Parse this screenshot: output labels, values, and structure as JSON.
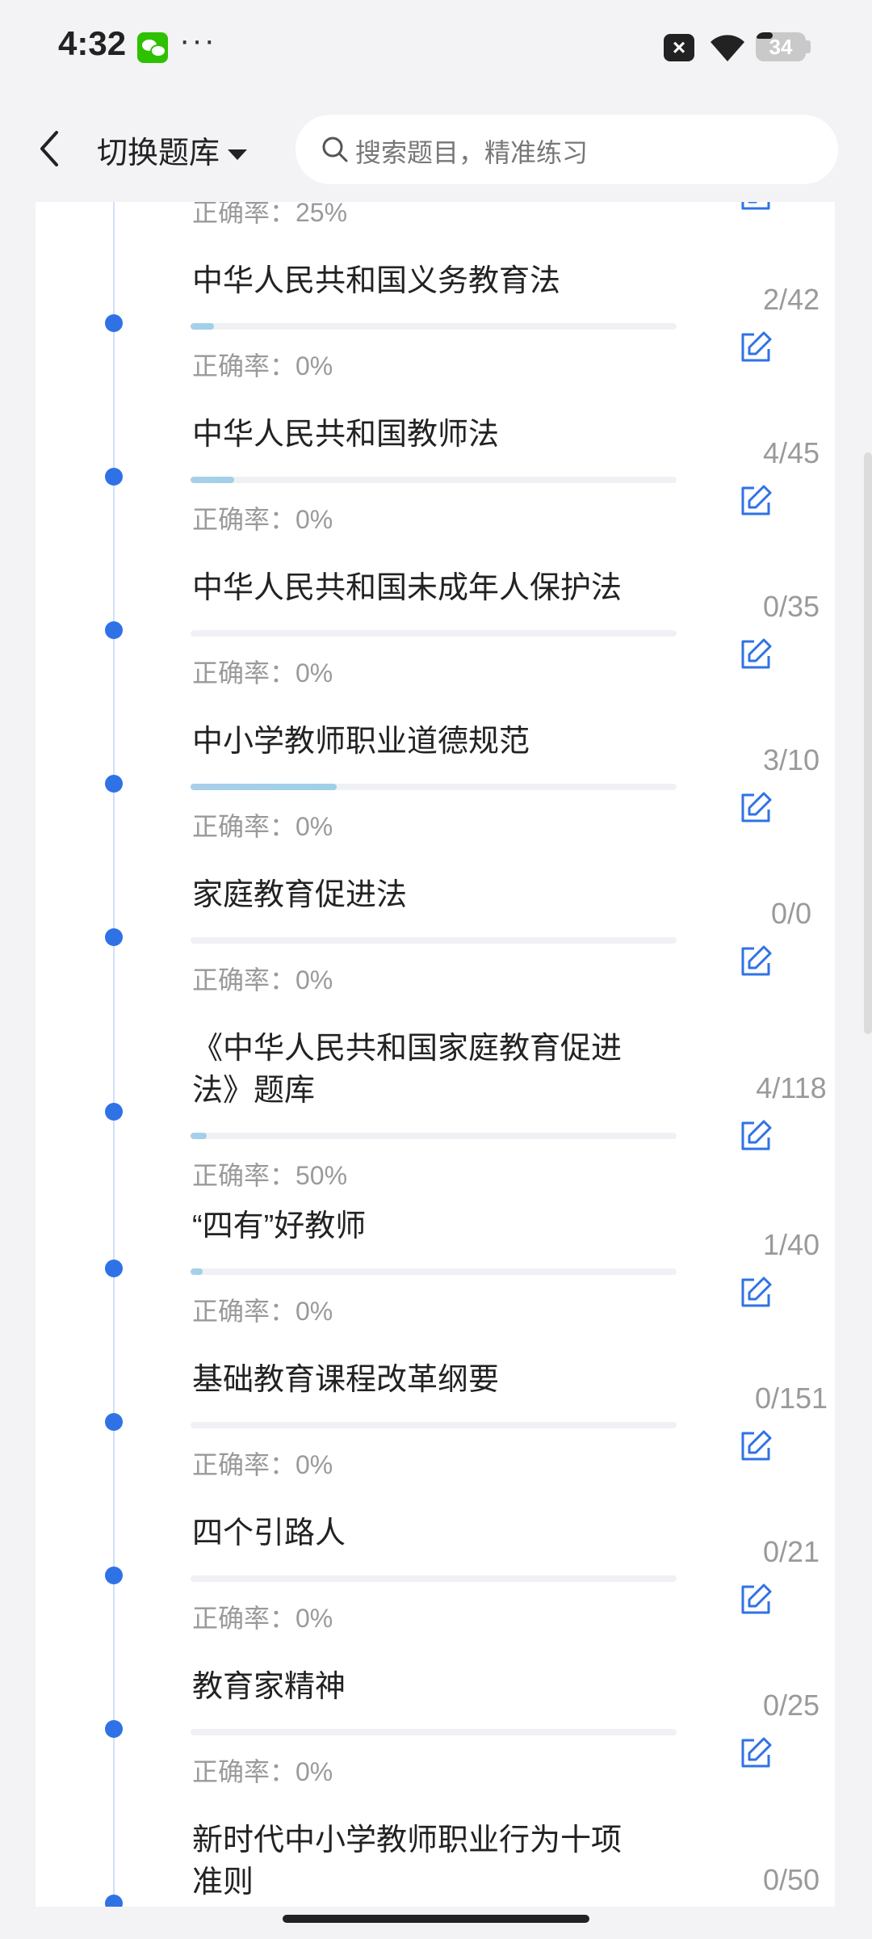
{
  "status_bar": {
    "time": "4:32",
    "dots": "···",
    "battery": "34",
    "icons": [
      "wechat-icon",
      "close-icon",
      "wifi-icon",
      "battery-icon"
    ]
  },
  "header": {
    "back_icon": "chevron-left-icon",
    "switch_label": "切换题库",
    "search_placeholder": "搜索题目，精准练习"
  },
  "accuracy_prefix": "正确率：",
  "partial_top_accuracy": "正确率：25%",
  "items": [
    {
      "title": "中华人民共和国义务教育法",
      "progress": 0.048,
      "count": "2/42",
      "accuracy": "正确率：0%"
    },
    {
      "title": "中华人民共和国教师法",
      "progress": 0.089,
      "count": "4/45",
      "accuracy": "正确率：0%"
    },
    {
      "title": "中华人民共和国未成年人保护法",
      "progress": 0,
      "count": "0/35",
      "accuracy": "正确率：0%"
    },
    {
      "title": "中小学教师职业道德规范",
      "progress": 0.3,
      "count": "3/10",
      "accuracy": "正确率：0%"
    },
    {
      "title": "家庭教育促进法",
      "progress": 0,
      "count": "0/0",
      "accuracy": "正确率：0%"
    },
    {
      "title": "《中华人民共和国家庭教育促进法》题库",
      "progress": 0.034,
      "count": "4/118",
      "accuracy": "正确率：50%"
    },
    {
      "title": "“四有”好教师",
      "progress": 0.025,
      "count": "1/40",
      "accuracy": "正确率：0%"
    },
    {
      "title": "基础教育课程改革纲要",
      "progress": 0,
      "count": "0/151",
      "accuracy": "正确率：0%"
    },
    {
      "title": "四个引路人",
      "progress": 0,
      "count": "0/21",
      "accuracy": "正确率：0%"
    },
    {
      "title": "教育家精神",
      "progress": 0,
      "count": "0/25",
      "accuracy": "正确率：0%"
    },
    {
      "title": "新时代中小学教师职业行为十项准则",
      "progress": 0,
      "count": "0/50",
      "accuracy": ""
    }
  ],
  "colors": {
    "accent": "#2f72e6",
    "progress_fill": "#a9cfea",
    "muted_text": "#9a9a9a"
  }
}
